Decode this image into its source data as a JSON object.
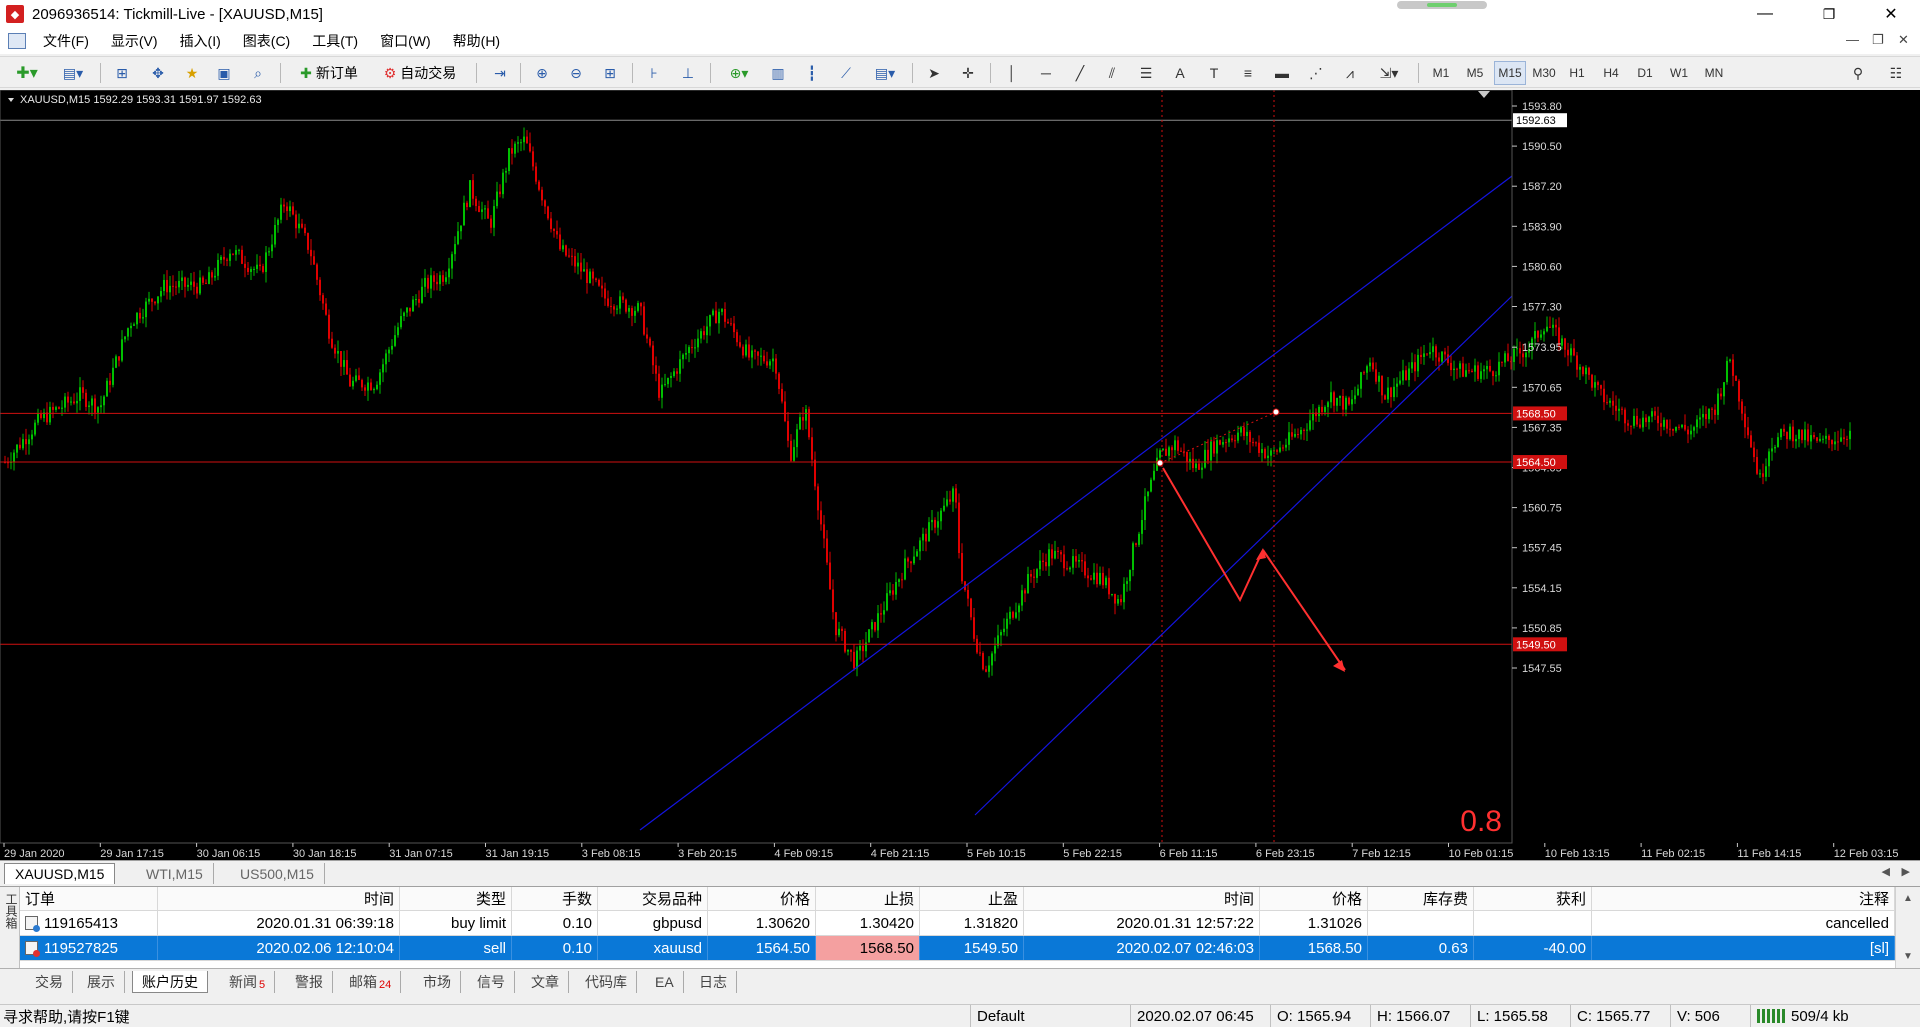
{
  "window": {
    "title": "2096936514: Tickmill-Live - [XAUUSD,M15]",
    "controls": {
      "minimize": "—",
      "restore": "❐",
      "close": "✕"
    }
  },
  "menu": [
    "文件(F)",
    "显示(V)",
    "插入(I)",
    "图表(C)",
    "工具(T)",
    "窗口(W)",
    "帮助(H)"
  ],
  "mdi_controls": {
    "minimize": "—",
    "restore": "❐",
    "close": "✕"
  },
  "toolbar": {
    "new_order": "新订单",
    "auto_trading": "自动交易",
    "timeframes": [
      "M1",
      "M5",
      "M15",
      "M30",
      "H1",
      "H4",
      "D1",
      "W1",
      "MN"
    ],
    "active_timeframe": "M15"
  },
  "chart": {
    "symbol_header": "XAUUSD,M15  1592.29 1593.31 1591.97 1592.63",
    "price_labels": [
      "1593.80",
      "1590.50",
      "1587.20",
      "1583.90",
      "1580.60",
      "1577.30",
      "1573.95",
      "1570.65",
      "1567.35",
      "1564.05",
      "1560.75",
      "1557.45",
      "1554.15",
      "1550.85",
      "1547.55"
    ],
    "current_price_tag": "1592.63",
    "level_tags": [
      "1568.50",
      "1564.50",
      "1549.50"
    ],
    "time_labels": [
      "29 Jan 2020",
      "29 Jan 17:15",
      "30 Jan 06:15",
      "30 Jan 18:15",
      "31 Jan 07:15",
      "31 Jan 19:15",
      "3 Feb 08:15",
      "3 Feb 20:15",
      "4 Feb 09:15",
      "4 Feb 21:15",
      "5 Feb 10:15",
      "5 Feb 22:15",
      "6 Feb 11:15",
      "6 Feb 23:15",
      "7 Feb 12:15",
      "10 Feb 01:15",
      "10 Feb 13:15",
      "11 Feb 02:15",
      "11 Feb 14:15",
      "12 Feb 03:15"
    ],
    "corner_value": "0.8",
    "colors": {
      "bull": "#00c000",
      "bear": "#e00000",
      "channel": "#1414e0",
      "level": "#d01010",
      "arrow": "#ff3030"
    }
  },
  "symbol_tabs": [
    "XAUUSD,M15",
    "WTI,M15",
    "US500,M15"
  ],
  "terminal": {
    "side_label": "工具箱",
    "columns": [
      "订单",
      "时间",
      "类型",
      "手数",
      "交易品种",
      "价格",
      "止损",
      "止盈",
      "时间",
      "价格",
      "库存费",
      "获利",
      "注释"
    ],
    "rows": [
      {
        "order": "119165413",
        "open_time": "2020.01.31 06:39:18",
        "type": "buy limit",
        "lots": "0.10",
        "symbol": "gbpusd",
        "price": "1.30620",
        "sl": "1.30420",
        "tp": "1.31820",
        "close_time": "2020.01.31 12:57:22",
        "close_price": "1.31026",
        "swap": "",
        "profit": "",
        "comment": "cancelled"
      },
      {
        "order": "119527825",
        "open_time": "2020.02.06 12:10:04",
        "type": "sell",
        "lots": "0.10",
        "symbol": "xauusd",
        "price": "1564.50",
        "sl": "1568.50",
        "tp": "1549.50",
        "close_time": "2020.02.07 02:46:03",
        "close_price": "1568.50",
        "swap": "0.63",
        "profit": "-40.00",
        "comment": "[sl]"
      }
    ]
  },
  "terminal_tabs": [
    {
      "label": "交易",
      "badge": ""
    },
    {
      "label": "展示",
      "badge": ""
    },
    {
      "label": "账户历史",
      "badge": ""
    },
    {
      "label": "新闻",
      "badge": "5"
    },
    {
      "label": "警报",
      "badge": ""
    },
    {
      "label": "邮箱",
      "badge": "24"
    },
    {
      "label": "市场",
      "badge": ""
    },
    {
      "label": "信号",
      "badge": ""
    },
    {
      "label": "文章",
      "badge": ""
    },
    {
      "label": "代码库",
      "badge": ""
    },
    {
      "label": "EA",
      "badge": ""
    },
    {
      "label": "日志",
      "badge": ""
    }
  ],
  "status": {
    "help": "寻求帮助,请按F1键",
    "profile": "Default",
    "datetime": "2020.02.07 06:45",
    "open": "O: 1565.94",
    "high": "H: 1566.07",
    "low": "L: 1565.58",
    "close": "C: 1565.77",
    "volume": "V: 506",
    "traffic": "509/4 kb"
  }
}
